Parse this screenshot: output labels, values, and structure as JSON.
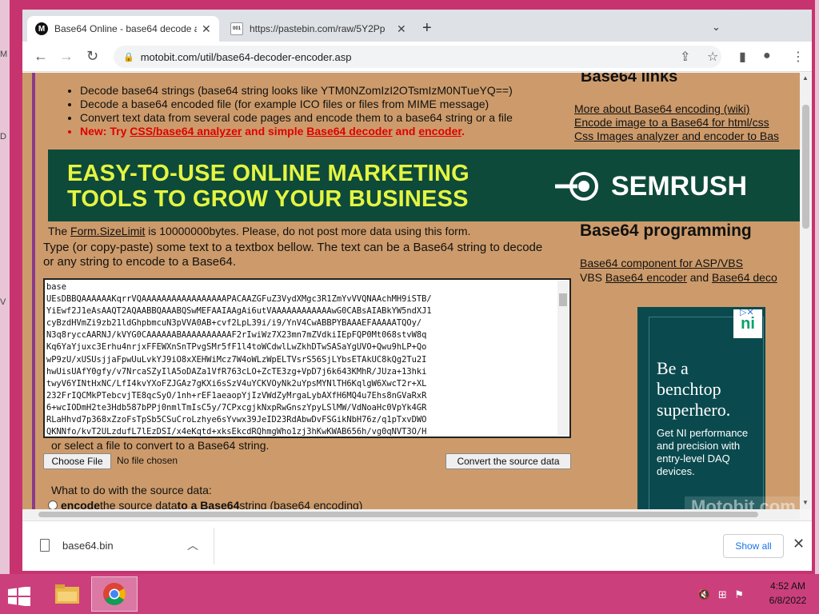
{
  "browser": {
    "tabs": [
      {
        "title": "Base64 Online - base64 decode a",
        "favicon": "M",
        "active": true
      },
      {
        "title": "https://pastebin.com/raw/5Y2Pp",
        "favicon": "001",
        "active": false
      }
    ],
    "new_tab": "+",
    "tab_menu": "⌄",
    "url": "motobit.com/util/base64-decoder-encoder.asp"
  },
  "page": {
    "features": [
      "Decode base64 strings (base64 string looks like YTM0NZomIzI2OTsmIzM0NTueYQ==)",
      "Decode a base64 encoded file (for example ICO files or files from MIME message)",
      "Convert text data from several code pages and encode them to a base64 string or a file"
    ],
    "feature_new": {
      "prefix": "New: Try ",
      "link1": "CSS/base64 analyzer",
      "mid": " and simple ",
      "link2": "Base64 decoder",
      "and": " and ",
      "link3": "encoder",
      "suffix": "."
    },
    "links_heading": "Base64 links",
    "links": [
      "More about Base64 encoding (wiki)",
      "Encode image to a Base64 for html/css",
      "Css Images analyzer and encoder to Bas"
    ],
    "ad": {
      "headline_1": "EASY-TO-USE ONLINE MARKETING",
      "headline_2": "TOOLS TO GROW YOUR BUSINESS",
      "brand": "SEMRUSH",
      "colors": {
        "bg": "#0e4a3a",
        "headline": "#e4f542"
      }
    },
    "form_limit": {
      "pre": "The ",
      "link": "Form.SizeLimit",
      "post": " is 10000000bytes. Please, do not post more data using this form."
    },
    "type_hint": "Type (or copy-paste) some text to a textbox bellow. The text can be a Base64 string to decode or any string to encode to a Base64.",
    "textarea_value": "base\nUEsDBBQAAAAAAKqrrVQAAAAAAAAAAAAAAAAAPACAAZGFuZ3VydXMgc3R1ZmYvVVQNAAchMH9iSTB/\nYiEwf2J1eAsAAQT2AQAABBQAAABQSwMEFAAIAAgAi6utVAAAAAAAAAAAAwG0CABsAIABkYW5ndXJ1\ncyBzdHVmZi9zb21ldGhpbmcuN3pVVA0AB+cvf2LpL39i/i9/YnV4CwABBPYBAAAEFAAAAATQOy/\nN3q8ryccAARNJ/kVYG0CAAAAAABAAAAAAAAAAF2rIwiWz7X23mn7mZVdkiIEpFQP0Mt068stvW8q\nKq6YaYjuxc3Erhu4nrjxFFEWXnSnTPvgSMr5fF1l4toWCdwlLwZkhDTwSASaYgUVO+Qwu9hLP+Qo\nwP9zU/xUSUsjjaFpwUuLvkYJ9iO8xXEHWiMcz7W4oWLzWpELTVsrS56SjLYbsETAkUC8kQg2Tu2I\nhwUisUAfY0gfy/v7NrcaSZyIlA5oDAZa1VfR763cLO+ZcTE3zg+VpD7j6k643KMhR/JUza+13hki\ntwyV6YINtHxNC/LfI4kvYXoFZJGAz7gKXi6sSzV4uYCKVOyNk2uYpsMYNlTH6KqlgW6XwcT2r+XL\n232FrIQCMkPTebcvjTE8qcSyO/1nh+rEF1aeaopYjIzVWdZyMrgaLybAXfH6MQ4u7Ehs8nGVaRxR\n6+wcIODmH2te3Hdb587bPPj0nmlTmIsC5y/7CPxcgjkNxpRwGnszYpyLSlMW/VdNoaHc0VpYk4GR\nRLaHhvd7p368xZzoFsTpSb5CSuCroLzhye6sYvwx39JeID23RdAbwDvFSGikNbH76z/q1pTxvDWO\nQKNNfo/kvT2ULzdufL7lEzDSI/x4eKqtd+xksEkcdRQhmgWho1zj3hKwKWAB656h/vg0qNVT3O/H",
    "or_select": "or select a file to convert to a Base64 string.",
    "choose_file": "Choose File",
    "no_file": "No file chosen",
    "convert_btn": "Convert the source data",
    "what_to_do": "What to do with the source data:",
    "encode_option": {
      "b1": "encode",
      "t1": " the source data ",
      "b2": "to a Base64",
      "t2": " string (base64 encoding)"
    },
    "prog_heading": "Base64 programming",
    "prog_line1_link": "Base64 component for ASP/VBS",
    "prog_line2": {
      "pre": "VBS ",
      "link1": "Base64 encoder",
      "mid": " and ",
      "link2": "Base64 deco"
    },
    "side_ad": {
      "logo": "ni",
      "headline": "Be a benchtop superhero.",
      "body": "Get NI performance and precision with entry-level DAQ devices."
    },
    "watermark": "Motobit.com"
  },
  "downloads": {
    "file": "base64.bin",
    "show_all": "Show all"
  },
  "taskbar": {
    "time": "4:52 AM",
    "date": "6/8/2022"
  }
}
